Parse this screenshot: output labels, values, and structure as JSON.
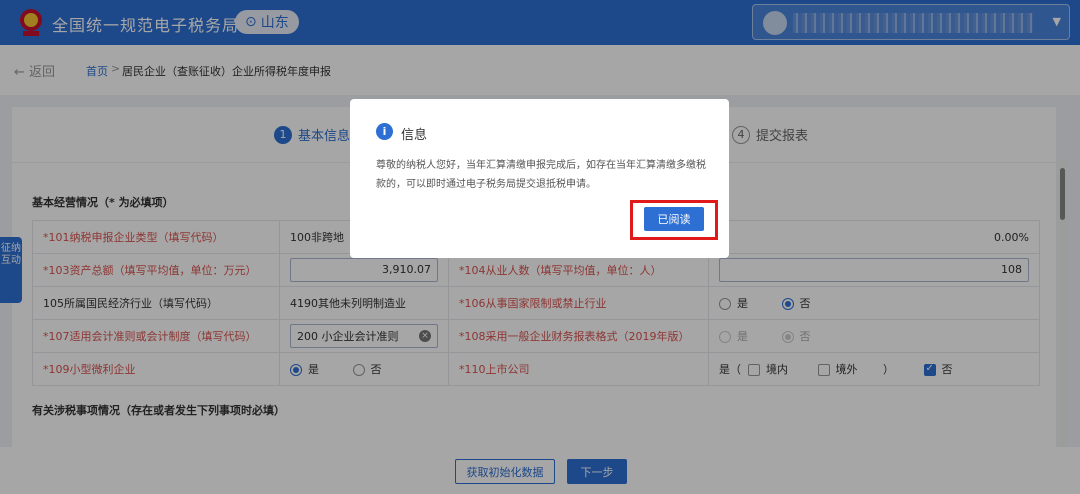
{
  "header": {
    "title": "全国统一规范电子税务局",
    "region": "山东",
    "region_icon": "location-pin-icon",
    "colors": {
      "brand": "#2d6fd3",
      "header_bg": "#2d6fd3"
    }
  },
  "breadcrumb": {
    "back_label": "返回",
    "home_label": "首页",
    "separator": ">",
    "current": "居民企业（查账征收）企业所得税年度申报"
  },
  "steps": {
    "active_num": "1",
    "active_label": "基本信息",
    "last_num": "4",
    "last_label": "提交报表"
  },
  "section1_title": "基本经营情况（* 为必填项）",
  "section2_title": "有关涉税事项情况（存在或者发生下列事项时必填）",
  "rows": {
    "r1": {
      "label": "*101纳税申报企业类型（填写代码）",
      "value": "100非跨地",
      "right_value": "0.00%"
    },
    "r2": {
      "label_prefix": "*103资产总额",
      "label_hint": "（填写平均值，单位：万元）",
      "value": "3,910.07",
      "label2_prefix": "*104从业人数",
      "label2_hint": "（填写平均值，单位：人）",
      "value2": "108"
    },
    "r3": {
      "label": "105所属国民经济行业（填写代码）",
      "value": "4190其他未列明制造业",
      "label2": "*106从事国家限制或禁止行业",
      "yes": "是",
      "no": "否"
    },
    "r4": {
      "label": "*107适用会计准则或会计制度（填写代码）",
      "value": "200 小企业会计准则",
      "label2": "*108采用一般企业财务报表格式（2019年版）",
      "yes": "是",
      "no": "否"
    },
    "r5": {
      "label": "*109小型微利企业",
      "yes": "是",
      "no": "否",
      "label2": "*110上市公司",
      "listed_prefix": "是（",
      "domestic": "境内",
      "overseas": "境外",
      "close": "）",
      "no2": "否"
    }
  },
  "side_tab": "征纳互动",
  "footer": {
    "init_button": "获取初始化数据",
    "next_button": "下一步"
  },
  "dialog": {
    "icon": "info-icon",
    "title": "信息",
    "message": "尊敬的纳税人您好，当年汇算清缴申报完成后，如存在当年汇算清缴多缴税款的，可以即时通过电子税务局提交退抵税申请。",
    "confirm_label": "已阅读",
    "highlight_color": "#e0191b"
  }
}
